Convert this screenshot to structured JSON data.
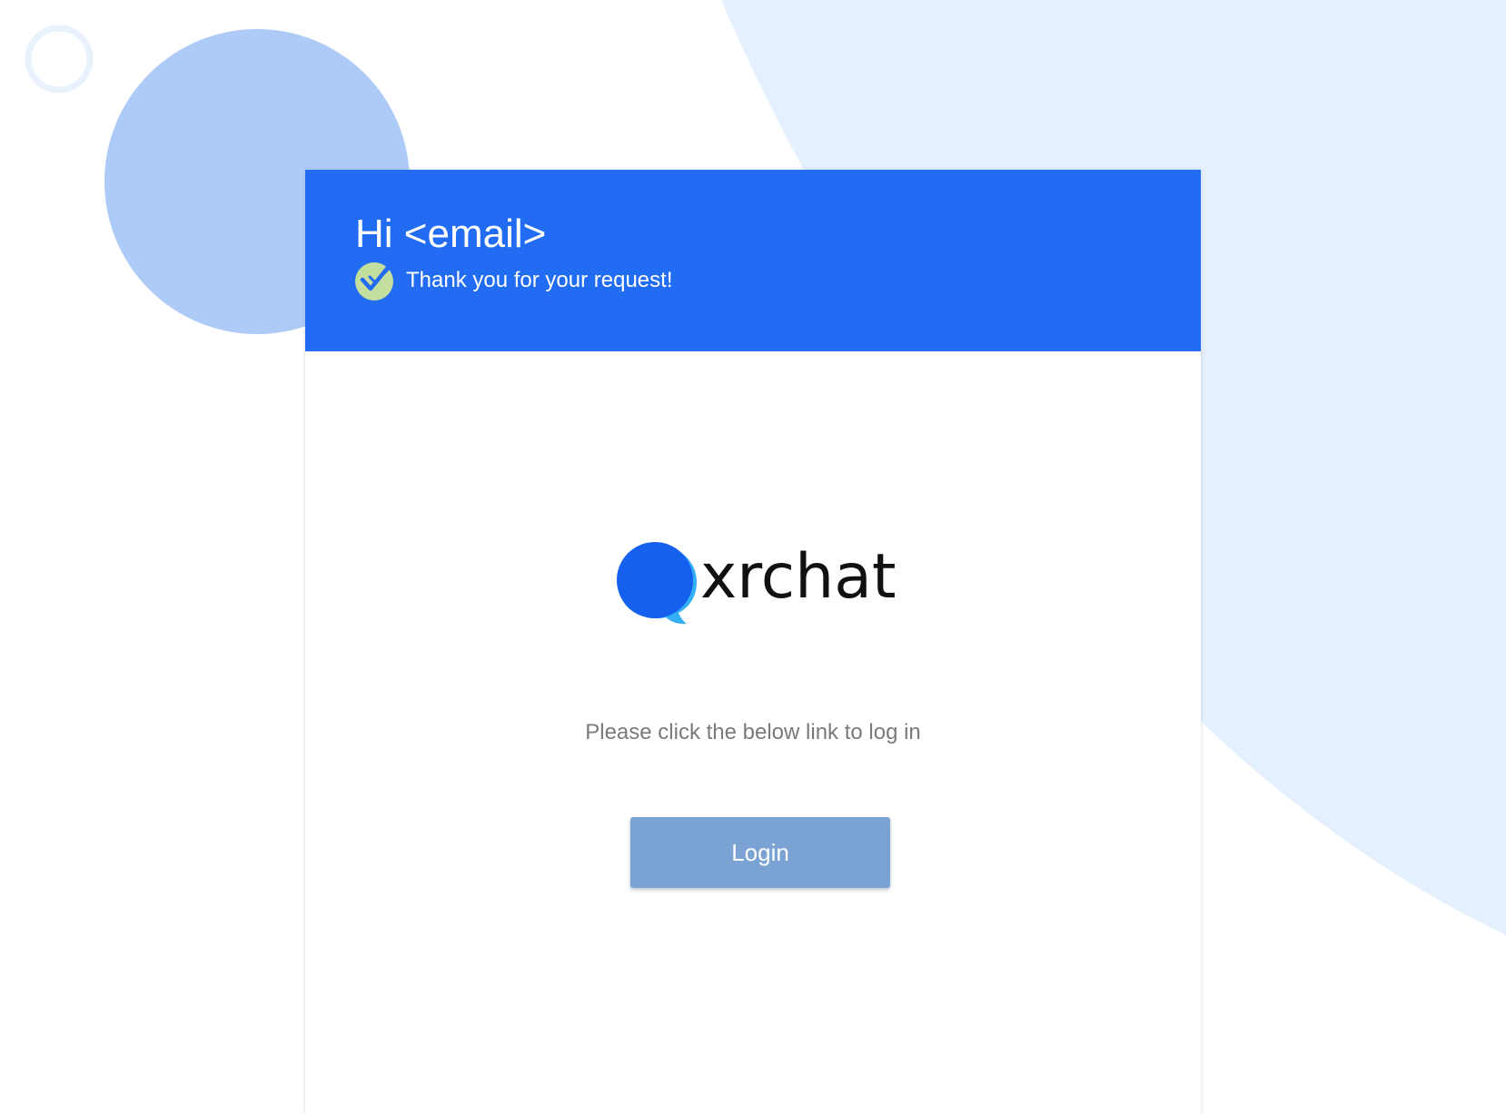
{
  "header": {
    "greeting": "Hi <email>",
    "thanks_message": "Thank you for your request!"
  },
  "logo": {
    "text": "xrchat"
  },
  "body": {
    "instruction": "Please click the below link to log in"
  },
  "actions": {
    "login_label": "Login"
  },
  "colors": {
    "header_bg": "#216cf2",
    "button_bg": "#7aa2d2",
    "check_badge": "#c4de9d",
    "logo_primary": "#1660f0",
    "logo_secondary": "#34aef5",
    "background_shape": "#e4f0fd",
    "background_circle": "#aecbf8"
  },
  "icons": {
    "check": "check-badge-icon",
    "logo_mark": "chat-bubble-icon"
  }
}
